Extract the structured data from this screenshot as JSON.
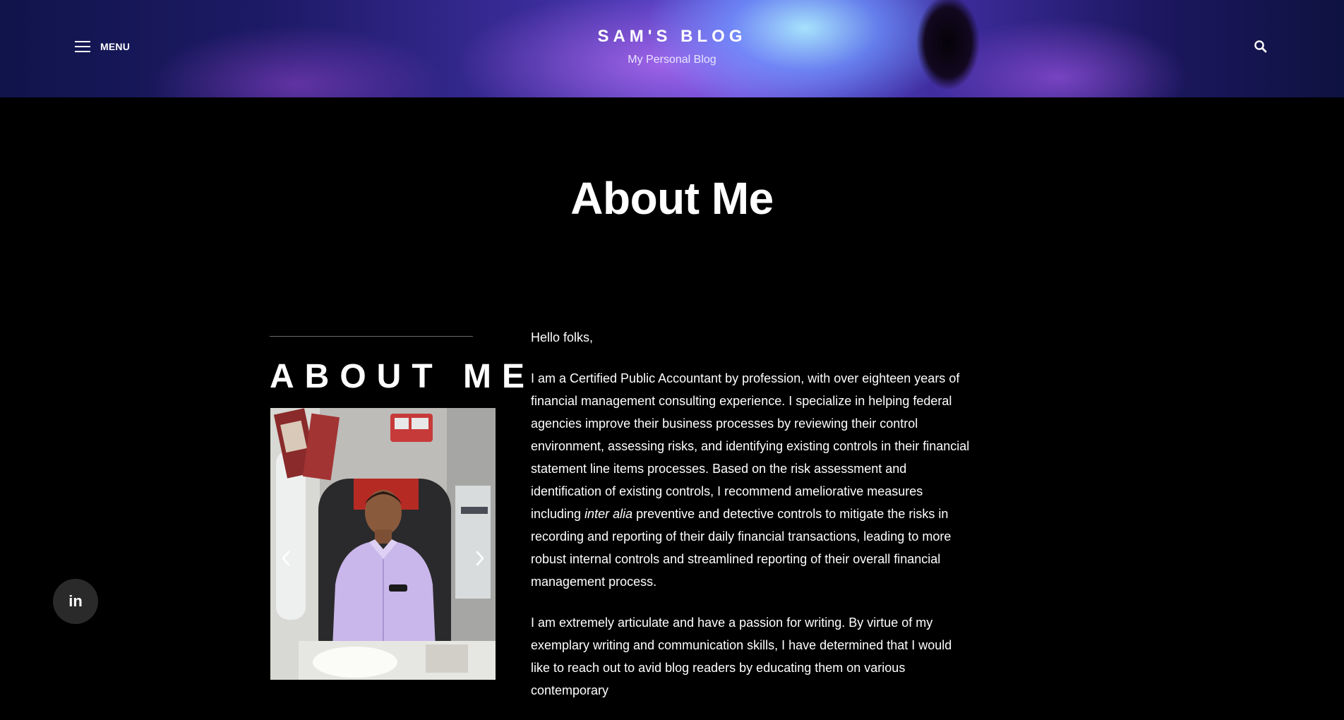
{
  "header": {
    "menu_label": "MENU",
    "site_title": "SAM'S BLOG",
    "tagline": "My Personal Blog",
    "icons": {
      "menu": "hamburger-icon",
      "search": "search-icon"
    }
  },
  "page": {
    "title": "About Me"
  },
  "sidebar": {
    "heading": "ABOUT ME",
    "slider_icons": {
      "prev": "chevron-left-icon",
      "next": "chevron-right-icon"
    }
  },
  "article": {
    "greeting": "Hello folks,",
    "p1_before": "I am a Certified Public Accountant by profession, with over eighteen years of financial management consulting experience. I specialize in helping federal agencies improve their business processes by reviewing their control environment, assessing risks, and identifying existing controls in their financial statement line items processes. Based on the risk assessment and identification of existing controls, I recommend ameliorative measures including ",
    "p1_italic": "inter alia",
    "p1_after": " preventive and detective controls to mitigate the risks in recording and reporting of their daily financial transactions, leading to more robust internal controls and streamlined reporting of their overall financial management process.",
    "p2": "I am extremely articulate and have a passion for writing. By virtue of my exemplary writing and communication skills, I have determined that I would like to reach out to avid blog readers by educating them on various contemporary"
  },
  "social": {
    "linkedin_label": "in",
    "icon": "linkedin-icon"
  },
  "colors": {
    "background": "#000000",
    "text": "#ffffff",
    "social_button": "#2a2a2a"
  }
}
